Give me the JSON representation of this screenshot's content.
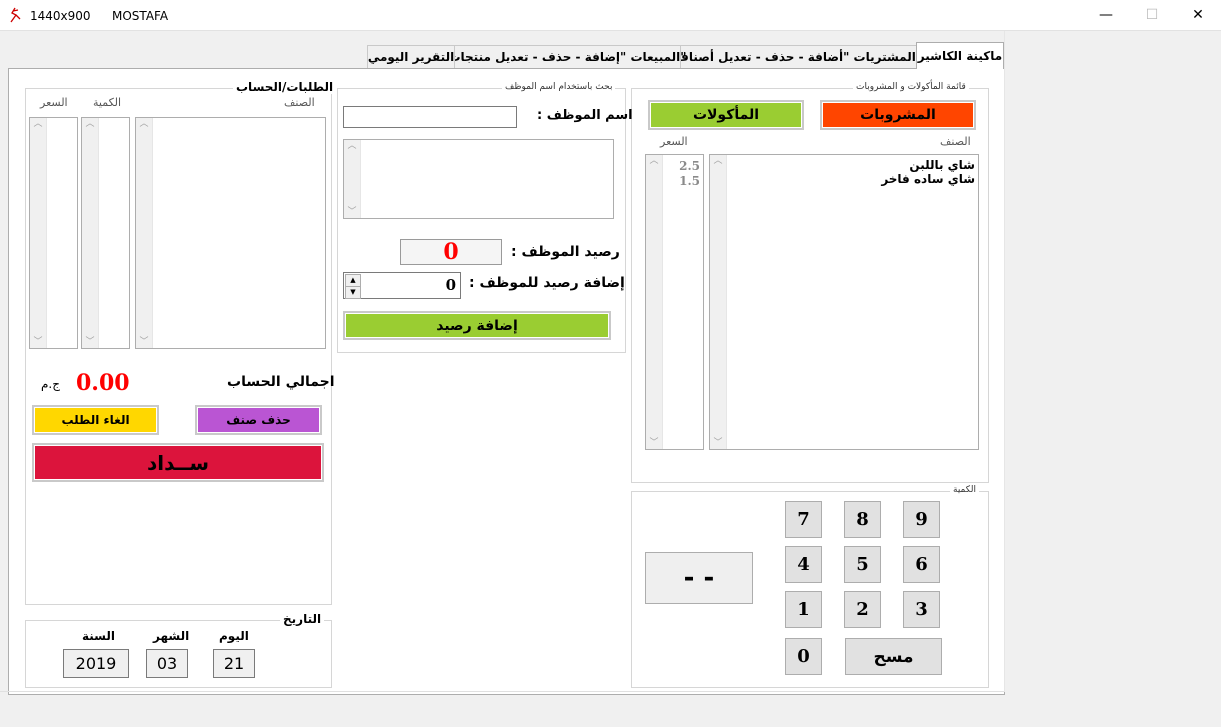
{
  "window": {
    "resolution": "1440x900",
    "title": "MOSTAFA",
    "minimize": "—",
    "maximize": "☐",
    "close": "✕"
  },
  "tabs": [
    {
      "label": "ماكينة الكاشير"
    },
    {
      "label": "المشتريات \"أضافة - حذف - تعديل أصناف\""
    },
    {
      "label": "المبيعات \"إضافة - حذف - تعديل منتجات\""
    },
    {
      "label": "التقرير اليومي"
    }
  ],
  "menu_group": {
    "title": "قائمة المأكولات و المشروبات",
    "drinks_button": "المشروبات",
    "food_button": "المأكولات",
    "item_header": "الصنف",
    "price_header": "السعر",
    "items": [
      "شاي باللبن",
      "شاي ساده فاخر"
    ],
    "prices": [
      "2.5",
      "1.5"
    ],
    "colors": {
      "drinks": "#ff4500",
      "food": "#9acd32"
    }
  },
  "quantity_group": {
    "title": "الكمية",
    "display": "- -",
    "keys": [
      "9",
      "8",
      "7",
      "6",
      "5",
      "4",
      "3",
      "2",
      "1",
      "0"
    ],
    "clear_label": "مسح"
  },
  "employee_group": {
    "title": "بحث باستخدام اسم الموظف",
    "name_label": "اسم الموظف :",
    "name_value": "",
    "balance_label": "رصيد الموظف :",
    "balance_value": "0",
    "add_balance_label": "إضافة رصيد للموظف :",
    "add_balance_value": "0",
    "add_balance_button": "إضافة رصيد"
  },
  "orders_group": {
    "title": "الطلبات/الحساب",
    "item_header": "الصنف",
    "qty_header": "الكمية",
    "price_header": "السعر",
    "total_label": "اجمالي الحساب",
    "total_value": "0.00",
    "currency": "ج.م",
    "delete_button": "حذف صنف",
    "cancel_button": "الغاء الطلب",
    "pay_button": "ســداد",
    "colors": {
      "delete": "#ba55d3",
      "cancel": "#ffd700",
      "pay": "#dc143c",
      "total": "#ff0000"
    }
  },
  "date_group": {
    "title": "التاريخ",
    "day_label": "اليوم",
    "month_label": "الشهر",
    "year_label": "السنة",
    "day": "21",
    "month": "03",
    "year": "2019"
  }
}
